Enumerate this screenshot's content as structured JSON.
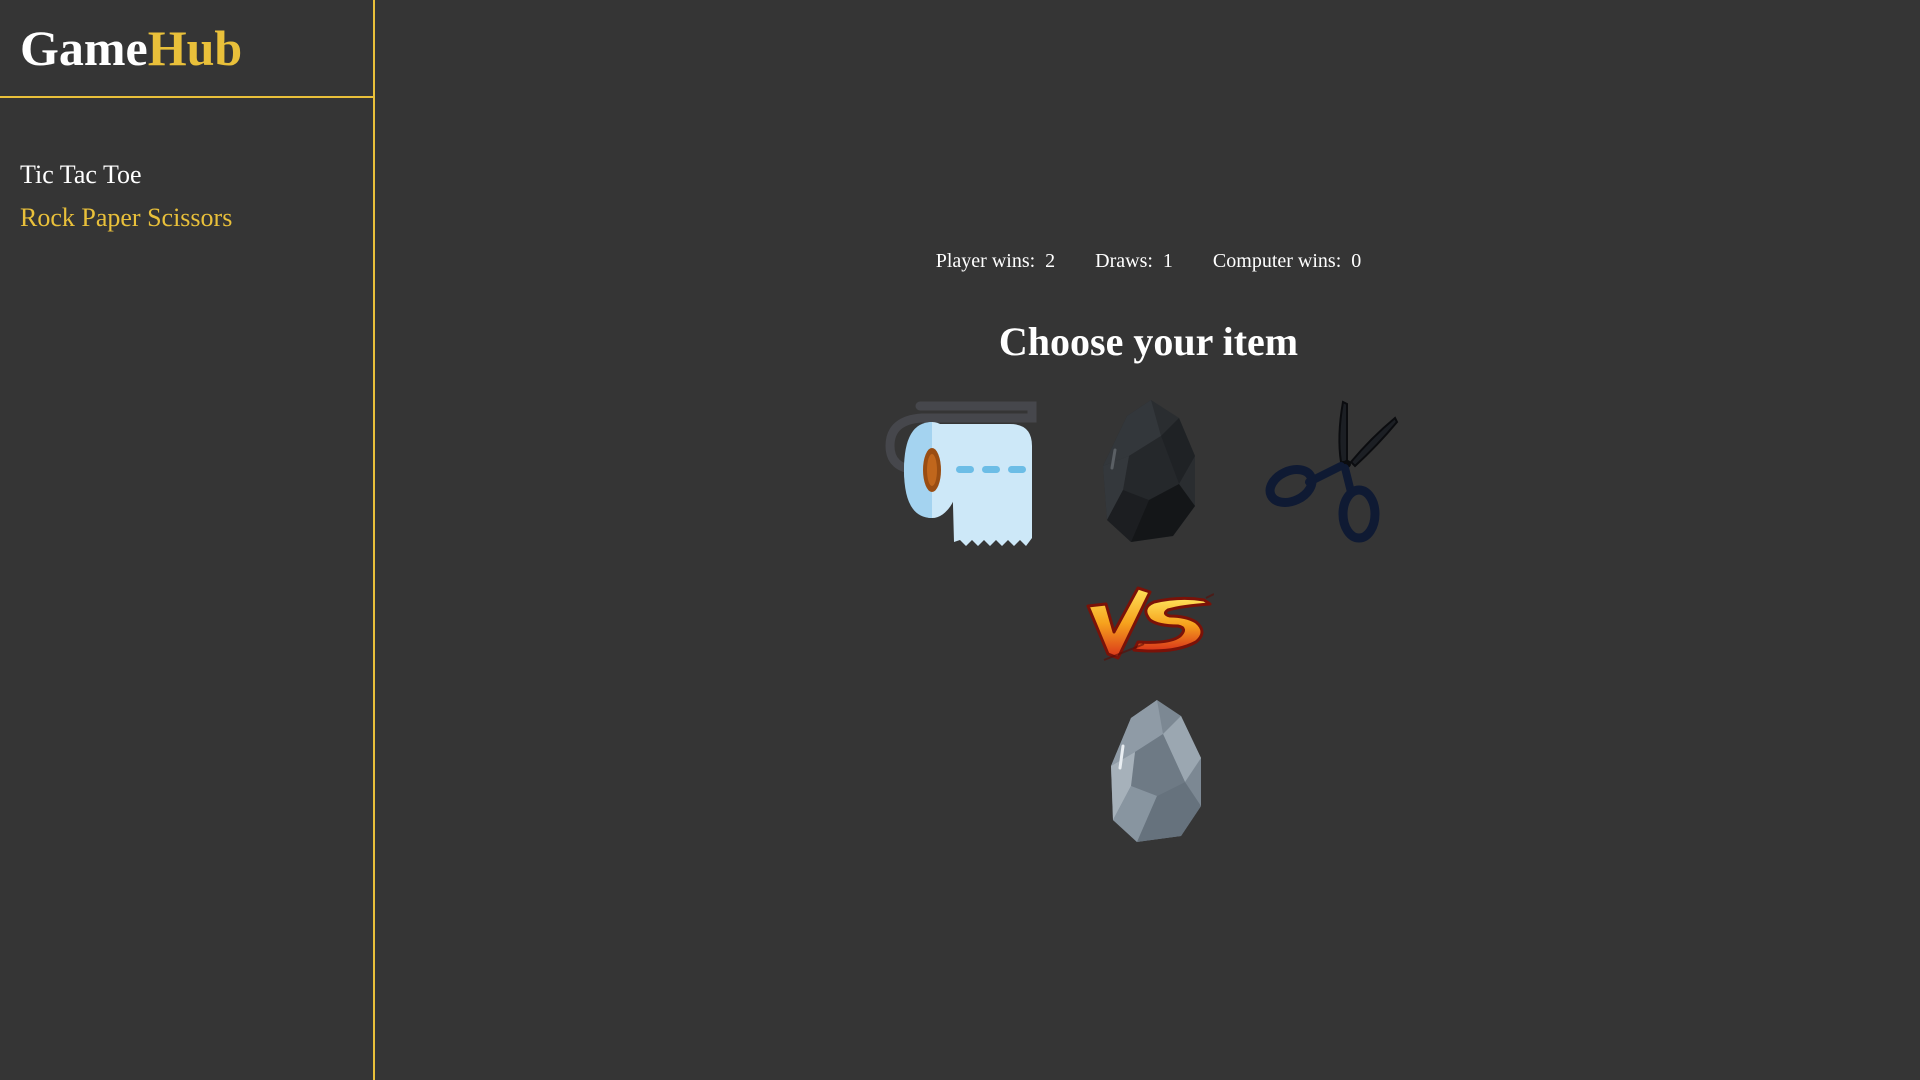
{
  "brand": {
    "part1": "Game",
    "part2": "Hub"
  },
  "nav": [
    {
      "label": "Tic Tac Toe",
      "active": false
    },
    {
      "label": "Rock Paper Scissors",
      "active": true
    }
  ],
  "score": {
    "player_label": "Player wins:",
    "player_value": "2",
    "draws_label": "Draws:",
    "draws_value": "1",
    "computer_label": "Computer wins:",
    "computer_value": "0"
  },
  "title": "Choose your item",
  "choices": [
    {
      "name": "paper",
      "icon": "toilet-paper-icon"
    },
    {
      "name": "rock",
      "icon": "rock-icon"
    },
    {
      "name": "scissors",
      "icon": "scissors-icon"
    }
  ],
  "result_icon": "rock-icon",
  "colors": {
    "accent": "#e9c03a",
    "background": "#353535",
    "text": "#ffffff"
  }
}
